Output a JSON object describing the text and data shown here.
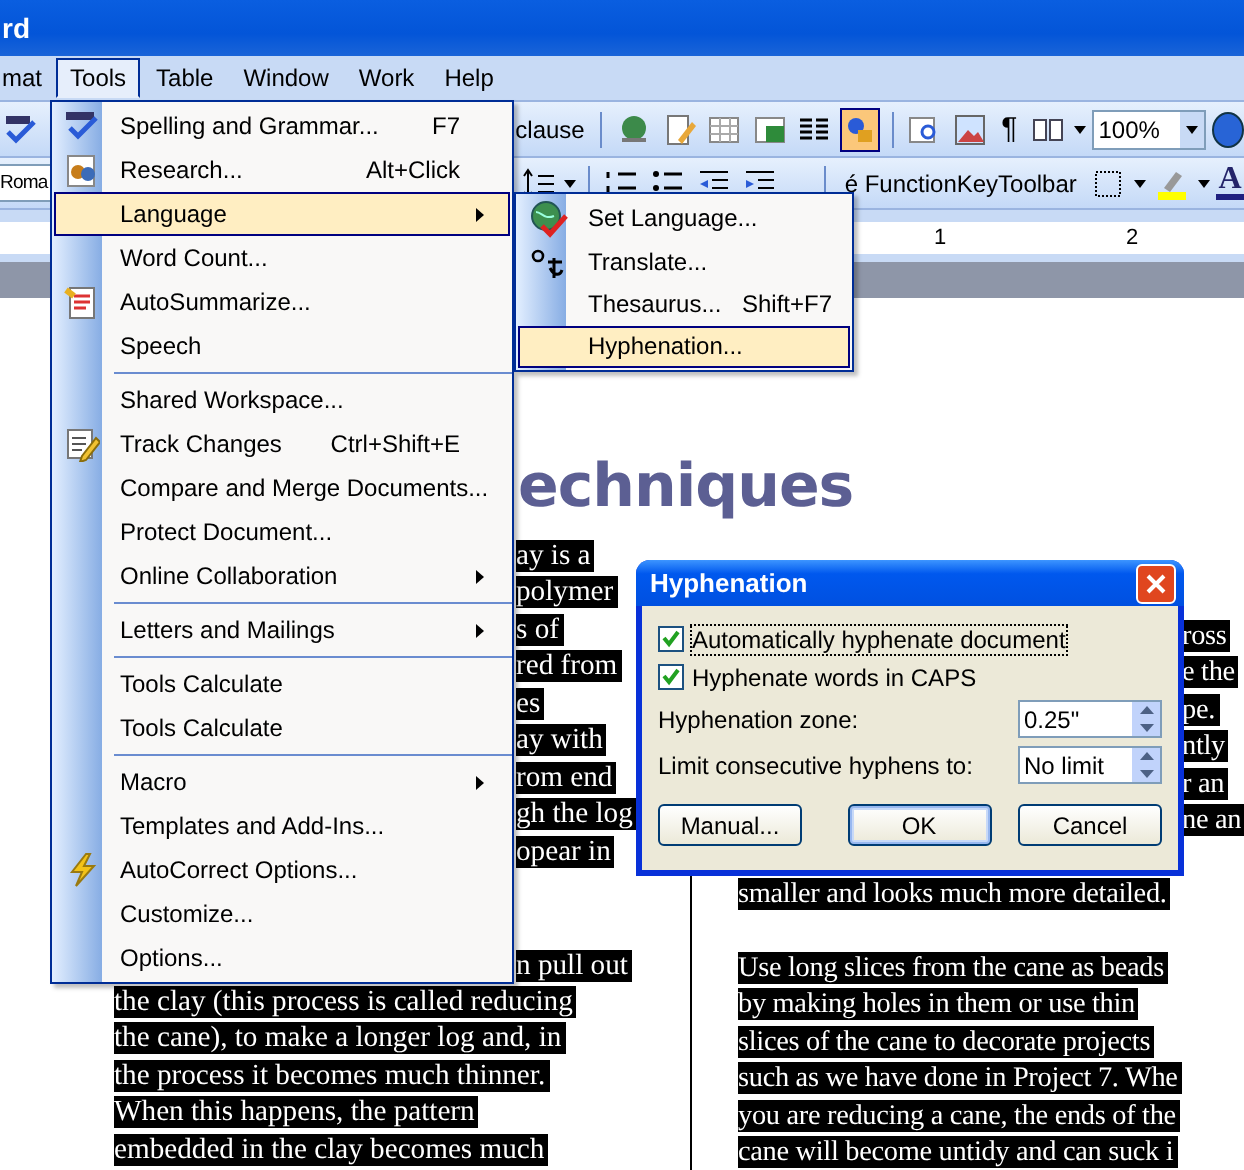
{
  "window": {
    "title": "rd"
  },
  "menubar": [
    {
      "label": "mat",
      "selected": false
    },
    {
      "label": "Tools",
      "selected": true
    },
    {
      "label": "Table",
      "selected": false
    },
    {
      "label": "Window",
      "selected": false
    },
    {
      "label": "Work",
      "selected": false
    },
    {
      "label": "Help",
      "selected": false
    }
  ],
  "toolbar_standard": {
    "clause_label": "clause",
    "pilcrow": "¶",
    "zoom": "100%"
  },
  "toolbar_formatting": {
    "font": "Roma",
    "function_key_toolbar": "é FunctionKeyToolbar",
    "font_color_glyph": "A"
  },
  "ruler": {
    "marks": [
      "1",
      "2"
    ]
  },
  "document": {
    "heading": "echniques",
    "left_column": {
      "fragments": [
        "ay is a",
        "polymer",
        "s of",
        "red from",
        "es",
        "ay with",
        "rom end",
        "gh the log",
        "opear in"
      ],
      "second_fragment": "n pull out",
      "lines": [
        "the clay (this process is called reducing",
        "the cane), to make a longer log and, in",
        "the process it becomes much thinner.",
        "When this happens, the pattern",
        "embedded in the clay becomes much"
      ]
    },
    "right_column": {
      "fragments": [
        "ross",
        "e the",
        "pe.",
        "ntly",
        "r an",
        "ne an"
      ],
      "first_line": "smaller and looks much more detailed.",
      "lines": [
        "Use long slices from the cane as beads",
        "by making holes in them or use thin",
        "slices of the cane to decorate projects",
        "such as we have done in Project 7. Whe",
        "you are reducing a cane, the ends of the",
        "cane will become untidy and can suck i"
      ]
    }
  },
  "tools_menu": {
    "items": [
      {
        "kind": "item",
        "label": "Spelling and Grammar...",
        "shortcut": "F7",
        "submenu": false,
        "selected": false
      },
      {
        "kind": "item",
        "label": "Research...",
        "shortcut": "Alt+Click",
        "submenu": false,
        "selected": false
      },
      {
        "kind": "item",
        "label": "Language",
        "submenu": true,
        "selected": true
      },
      {
        "kind": "item",
        "label": "Word Count...",
        "submenu": false,
        "selected": false
      },
      {
        "kind": "item",
        "label": "AutoSummarize...",
        "submenu": false,
        "selected": false
      },
      {
        "kind": "item",
        "label": "Speech",
        "submenu": false,
        "selected": false
      },
      {
        "kind": "separator"
      },
      {
        "kind": "item",
        "label": "Shared Workspace...",
        "submenu": false,
        "selected": false
      },
      {
        "kind": "item",
        "label": "Track Changes",
        "shortcut": "Ctrl+Shift+E",
        "submenu": false,
        "selected": false
      },
      {
        "kind": "item",
        "label": "Compare and Merge Documents...",
        "submenu": false,
        "selected": false
      },
      {
        "kind": "item",
        "label": "Protect Document...",
        "submenu": false,
        "selected": false
      },
      {
        "kind": "item",
        "label": "Online Collaboration",
        "submenu": true,
        "selected": false
      },
      {
        "kind": "separator"
      },
      {
        "kind": "item",
        "label": "Letters and Mailings",
        "submenu": true,
        "selected": false
      },
      {
        "kind": "separator"
      },
      {
        "kind": "item",
        "label": "Tools Calculate",
        "submenu": false,
        "selected": false
      },
      {
        "kind": "item",
        "label": "Tools Calculate",
        "submenu": false,
        "selected": false
      },
      {
        "kind": "separator"
      },
      {
        "kind": "item",
        "label": "Macro",
        "submenu": true,
        "selected": false
      },
      {
        "kind": "item",
        "label": "Templates and Add-Ins...",
        "submenu": false,
        "selected": false
      },
      {
        "kind": "item",
        "label": "AutoCorrect Options...",
        "submenu": false,
        "selected": false
      },
      {
        "kind": "item",
        "label": "Customize...",
        "submenu": false,
        "selected": false
      },
      {
        "kind": "item",
        "label": "Options...",
        "submenu": false,
        "selected": false
      }
    ]
  },
  "language_submenu": {
    "items": [
      {
        "label": "Set Language...",
        "selected": false
      },
      {
        "label": "Translate...",
        "selected": false
      },
      {
        "label": "Thesaurus...",
        "shortcut": "Shift+F7",
        "selected": false
      },
      {
        "label": "Hyphenation...",
        "selected": true
      }
    ]
  },
  "dialog": {
    "title": "Hyphenation",
    "checkboxes": [
      {
        "label": "Automatically hyphenate document",
        "checked": true,
        "focused": true
      },
      {
        "label": "Hyphenate words in CAPS",
        "checked": true,
        "focused": false
      }
    ],
    "fields": [
      {
        "label": "Hyphenation zone:",
        "value": "0.25\""
      },
      {
        "label": "Limit consecutive hyphens to:",
        "value": "No limit"
      }
    ],
    "buttons": [
      {
        "label": "Manual...",
        "default": false
      },
      {
        "label": "OK",
        "default": true
      },
      {
        "label": "Cancel",
        "default": false
      }
    ]
  }
}
